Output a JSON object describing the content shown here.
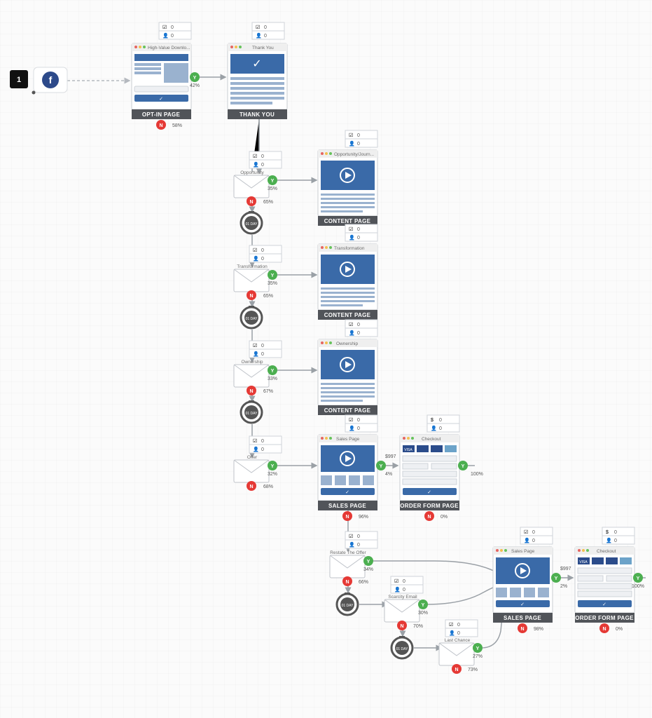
{
  "start_badge": "1",
  "stats_label": "0",
  "optin": {
    "title": "High-Value Downlo...",
    "footer": "OPT-IN PAGE",
    "yes": "42%",
    "no": "58%"
  },
  "thankyou": {
    "title": "Thank You",
    "footer": "THANK YOU"
  },
  "email_opportunity": {
    "title": "Opportunity",
    "yes": "35%",
    "no": "65%"
  },
  "content1": {
    "title": "Opportunity/Journ...",
    "footer": "CONTENT PAGE"
  },
  "email_transformation": {
    "title": "Transformation",
    "yes": "35%",
    "no": "65%"
  },
  "content2": {
    "title": "Transformation",
    "footer": "CONTENT PAGE"
  },
  "email_ownership": {
    "title": "Ownership",
    "yes": "33%",
    "no": "67%"
  },
  "content3": {
    "title": "Ownership",
    "footer": "CONTENT PAGE"
  },
  "email_offer": {
    "title": "Offer",
    "yes": "32%",
    "no": "68%"
  },
  "sales1": {
    "title": "Sales Page",
    "footer": "SALES PAGE",
    "yes": "4%",
    "no": "96%",
    "price": "$997"
  },
  "checkout1": {
    "title": "Checkout",
    "footer": "ORDER FORM PAGE",
    "yes": "100%",
    "no": "0%"
  },
  "email_restate": {
    "title": "Restate The Offer",
    "yes": "34%",
    "no": "66%"
  },
  "email_scarcity": {
    "title": "Scarcity Email",
    "yes": "30%",
    "no": "70%"
  },
  "email_lastchance": {
    "title": "Last Chance",
    "yes": "27%",
    "no": "73%"
  },
  "sales2": {
    "title": "Sales Page",
    "footer": "SALES PAGE",
    "yes": "2%",
    "no": "98%",
    "price": "$997"
  },
  "checkout2": {
    "title": "Checkout",
    "footer": "ORDER FORM PAGE",
    "yes": "100%",
    "no": "0%"
  },
  "timer_label": "01 DAY"
}
